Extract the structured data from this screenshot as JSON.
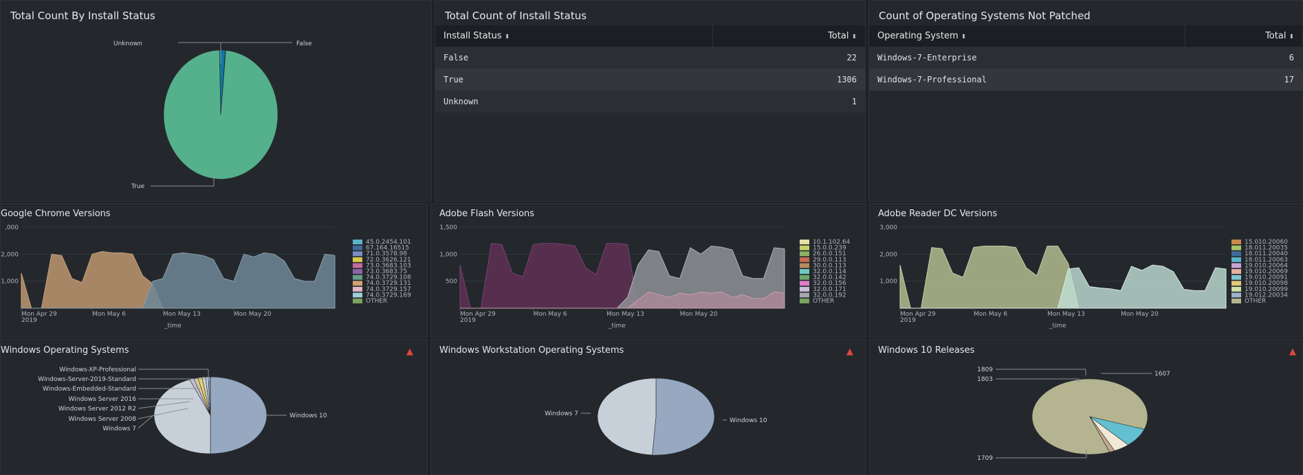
{
  "colors": {
    "green": "#55b08c",
    "blue": "#0f78a3",
    "brown": "#b5906b",
    "slate": "#6f8798",
    "purple": "#5a2e50",
    "gray": "#8e9195",
    "khaki": "#aab28a",
    "mint": "#c2e0d6",
    "lightblue": "#96a9c1",
    "pale": "#c7d0d9"
  },
  "panel1": {
    "title": "Total Count By Install Status",
    "chart_data": {
      "type": "pie",
      "slices": [
        {
          "label": "True",
          "value": 1306
        },
        {
          "label": "False",
          "value": 22
        },
        {
          "label": "Unknown",
          "value": 1
        }
      ]
    }
  },
  "panel2": {
    "title": "Total Count of Install Status",
    "col1": "Install Status",
    "col2": "Total",
    "sort_icon": "⬍",
    "rows": [
      {
        "k": "False",
        "v": "22"
      },
      {
        "k": "True",
        "v": "1306"
      },
      {
        "k": "Unknown",
        "v": "1"
      }
    ]
  },
  "panel3": {
    "title": "Count of Operating Systems Not Patched",
    "col1": "Operating System",
    "col2": "Total",
    "sort_icon": "⬍",
    "rows": [
      {
        "k": "Windows-7-Enterprise",
        "v": "6"
      },
      {
        "k": "Windows-7-Professional",
        "v": "17"
      }
    ]
  },
  "xaxis": {
    "ticks": [
      "Mon Apr 29",
      "Mon May 6",
      "Mon May 13",
      "Mon May 20"
    ],
    "year": "2019",
    "label": "_time"
  },
  "chrome": {
    "title": "Google Chrome Versions",
    "chart_data": {
      "type": "area",
      "yticks": [
        ",000",
        "2,000",
        "1,000"
      ],
      "legend": [
        "45.0.2454.101",
        "67.164.16515",
        "71.0.3578.98",
        "72.0.3626.121",
        "73.0.3683.103",
        "73.0.3683.75",
        "74.0.3729.108",
        "74.0.3729.131",
        "74.0.3729.157",
        "74.0.3729.169",
        "OTHER"
      ],
      "legend_colors": [
        "#5ab4c9",
        "#3f6b9a",
        "#7b8cc4",
        "#d9c94b",
        "#c46a9c",
        "#8b64a8",
        "#6a9e8c",
        "#d4a273",
        "#e0b8c8",
        "#9ecfd9",
        "#7aa15d"
      ],
      "series": [
        {
          "name": "brown",
          "values": [
            1300,
            0,
            0,
            2000,
            1950,
            1100,
            950,
            2000,
            2100,
            2050,
            2050,
            2000,
            1200,
            900,
            0,
            0,
            0,
            0,
            0,
            0,
            0,
            0,
            0,
            0,
            0,
            0,
            0,
            0,
            0,
            0,
            0,
            0
          ]
        },
        {
          "name": "slate",
          "values": [
            0,
            0,
            0,
            0,
            0,
            0,
            0,
            0,
            0,
            0,
            0,
            0,
            0,
            1000,
            1100,
            2000,
            2050,
            2000,
            1950,
            1800,
            1100,
            1000,
            2000,
            1900,
            2050,
            2000,
            1750,
            1100,
            1000,
            1000,
            2000,
            1950
          ]
        }
      ]
    }
  },
  "flash": {
    "title": "Adobe Flash Versions",
    "chart_data": {
      "type": "area",
      "yticks": [
        "1,500",
        "1,000",
        "500"
      ],
      "legend": [
        "10.1.102.64",
        "15.0.0.239",
        "26.0.0.151",
        "29.0.0.113",
        "30.0.0.113",
        "32.0.0.114",
        "32.0.0.142",
        "32.0.0.156",
        "32.0.0.171",
        "32.0.0.192",
        "OTHER"
      ],
      "legend_colors": [
        "#e6dfa8",
        "#c9d16a",
        "#8bb364",
        "#c96a53",
        "#b68b5c",
        "#6ec8c2",
        "#6fa66a",
        "#e27cc6",
        "#c9bfd6",
        "#a3a7ad",
        "#7aa15d"
      ],
      "series": [
        {
          "name": "purple",
          "values": [
            800,
            0,
            0,
            1200,
            1180,
            650,
            580,
            1180,
            1200,
            1200,
            1180,
            1150,
            750,
            620,
            1200,
            1200,
            1180,
            0,
            0,
            0,
            0,
            0,
            0,
            0,
            0,
            0,
            0,
            0,
            0,
            0,
            0,
            0
          ]
        },
        {
          "name": "gray",
          "values": [
            0,
            0,
            0,
            0,
            0,
            0,
            0,
            0,
            0,
            0,
            0,
            0,
            0,
            0,
            0,
            0,
            200,
            800,
            1080,
            1050,
            600,
            550,
            1120,
            1000,
            1150,
            1130,
            1080,
            600,
            550,
            550,
            1120,
            1100
          ]
        },
        {
          "name": "mauve",
          "values": [
            0,
            0,
            0,
            0,
            0,
            0,
            0,
            0,
            0,
            0,
            0,
            0,
            0,
            0,
            0,
            0,
            0,
            150,
            300,
            250,
            200,
            280,
            250,
            300,
            280,
            300,
            200,
            250,
            180,
            180,
            300,
            280
          ]
        }
      ]
    }
  },
  "reader": {
    "title": "Adobe Reader DC Versions",
    "chart_data": {
      "type": "area",
      "yticks": [
        "3,000",
        "2,000",
        "1,000"
      ],
      "legend": [
        "15.010.20060",
        "18.011.20035",
        "18.011.20040",
        "18.011.20063",
        "19.010.20064",
        "19.010.20069",
        "19.010.20091",
        "19.010.20098",
        "19.010.20099",
        "19.012.20034",
        "OTHER"
      ],
      "legend_colors": [
        "#c98a4b",
        "#a6c46a",
        "#3f6b9a",
        "#5ab4c9",
        "#c6a2d6",
        "#e6b0a0",
        "#7ec6d3",
        "#e6c87a",
        "#cfe0a8",
        "#9fb3c9",
        "#b7b68a"
      ],
      "series": [
        {
          "name": "khaki",
          "values": [
            1600,
            0,
            0,
            2250,
            2200,
            1300,
            1150,
            2250,
            2300,
            2300,
            2300,
            2250,
            1500,
            1200,
            2300,
            2300,
            1650,
            0,
            0,
            0,
            0,
            0,
            0,
            0,
            0,
            0,
            0,
            0,
            0,
            0,
            0,
            0
          ]
        },
        {
          "name": "mint",
          "values": [
            0,
            0,
            0,
            0,
            0,
            0,
            0,
            0,
            0,
            0,
            0,
            0,
            0,
            0,
            0,
            0,
            1450,
            1500,
            800,
            750,
            720,
            650,
            1550,
            1400,
            1600,
            1550,
            1350,
            700,
            650,
            650,
            1500,
            1450
          ]
        }
      ]
    }
  },
  "winos": {
    "title": "Windows Operating Systems",
    "alert_icon": "▲",
    "chart_data": {
      "type": "pie",
      "slices": [
        {
          "label": "Windows 10",
          "value": 50
        },
        {
          "label": "Windows 7",
          "value": 44
        },
        {
          "label": "Windows Server 2008",
          "value": 1.2
        },
        {
          "label": "Windows Server 2012 R2",
          "value": 1.2
        },
        {
          "label": "Windows Server 2016",
          "value": 1.2
        },
        {
          "label": "Windows-Embedded-Standard",
          "value": 1
        },
        {
          "label": "Windows-Server-2019-Standard",
          "value": 0.8
        },
        {
          "label": "Windows-XP-Professional",
          "value": 0.6
        }
      ]
    }
  },
  "winws": {
    "title": "Windows Workstation Operating Systems",
    "alert_icon": "▲",
    "chart_data": {
      "type": "pie",
      "slices": [
        {
          "label": "Windows 10",
          "value": 51
        },
        {
          "label": "Windows 7",
          "value": 49
        }
      ]
    }
  },
  "win10": {
    "title": "Windows 10 Releases",
    "alert_icon": "▲",
    "chart_data": {
      "type": "pie",
      "slices": [
        {
          "label": "1709",
          "value": 86
        },
        {
          "label": "1607",
          "value": 8
        },
        {
          "label": "1803",
          "value": 4.5
        },
        {
          "label": "1809",
          "value": 1.5
        }
      ]
    }
  }
}
